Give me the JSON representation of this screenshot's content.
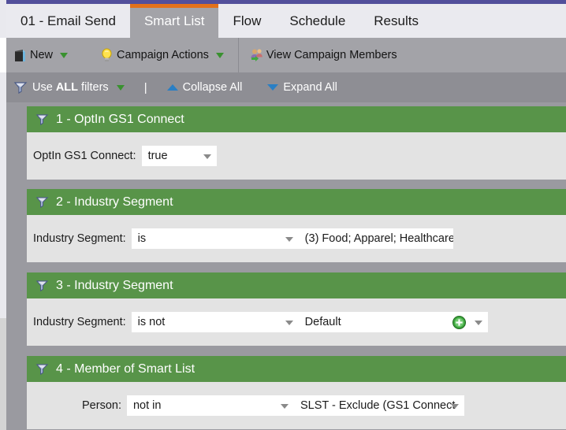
{
  "window": {
    "accent_purple": "#524f9b",
    "active_tab_accent": "#e2711b",
    "panel_header_green": "#589449",
    "chrome_gray": "#9a9aa0"
  },
  "tabs": [
    {
      "label": "01 - Email Send",
      "active": false
    },
    {
      "label": "Smart List",
      "active": true
    },
    {
      "label": "Flow",
      "active": false
    },
    {
      "label": "Schedule",
      "active": false
    },
    {
      "label": "Results",
      "active": false
    }
  ],
  "toolbar": {
    "new_label": "New",
    "campaign_actions_label": "Campaign Actions",
    "view_campaign_members_label": "View Campaign Members",
    "new_icon": "new-document-icon",
    "campaign_actions_icon": "lightbulb-icon",
    "view_members_icon": "users-arrow-icon"
  },
  "filter_bar": {
    "use_filters_prefix": "Use ",
    "use_filters_bold": "ALL",
    "use_filters_suffix": " filters",
    "separator": "|",
    "collapse_all_label": "Collapse All",
    "expand_all_label": "Expand All",
    "funnel_icon": "funnel-filter-icon"
  },
  "filters": [
    {
      "title": "1 - OptIn GS1 Connect",
      "field_label": "OptIn GS1 Connect:",
      "operator": "true",
      "value": "",
      "has_value_box": false,
      "has_plus": false
    },
    {
      "title": "2 - Industry Segment",
      "field_label": "Industry Segment:",
      "operator": "is",
      "value": "(3) Food; Apparel; Healthcare",
      "has_value_box": true,
      "has_plus": false
    },
    {
      "title": "3 - Industry Segment",
      "field_label": "Industry Segment:",
      "operator": "is not",
      "value": "Default",
      "has_value_box": true,
      "has_plus": true
    },
    {
      "title": "4 - Member of Smart List",
      "field_label": "Person:",
      "operator": "not in",
      "value": "SLST - Exclude (GS1 Connect",
      "has_value_box": true,
      "has_plus": false,
      "indented": true
    }
  ]
}
